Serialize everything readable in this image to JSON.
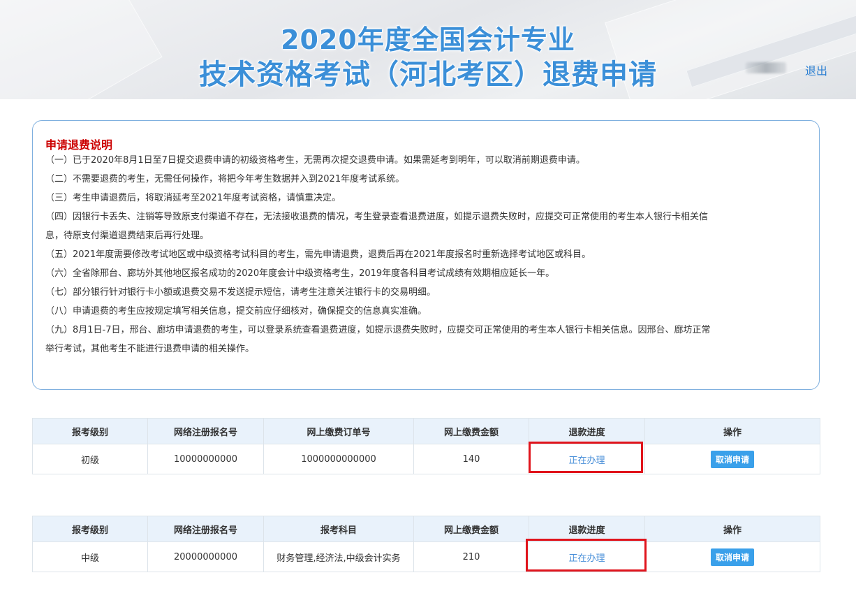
{
  "header": {
    "title_line1": "2020年度全国会计专业",
    "title_line2": "技术资格考试（河北考区）退费申请",
    "logout_label": "退出"
  },
  "notice": {
    "title": "申请退费说明",
    "items": [
      "（一）已于2020年8月1日至7日提交退费申请的初级资格考生，无需再次提交退费申请。如果需延考到明年，可以取消前期退费申请。",
      "（二）不需要退费的考生，无需任何操作，将把今年考生数据并入到2021年度考试系统。",
      "（三）考生申请退费后，将取消延考至2021年度考试资格，请慎重决定。",
      "（四）因银行卡丢失、注销等导致原支付渠道不存在，无法接收退费的情况，考生登录查看退费进度，如提示退费失败时，应提交可正常使用的考生本人银行卡相关信",
      "息，待原支付渠道退费结束后再行处理。",
      "（五）2021年度需要修改考试地区或中级资格考试科目的考生，需先申请退费，退费后再在2021年度报名时重新选择考试地区或科目。",
      "（六）全省除邢台、廊坊外其他地区报名成功的2020年度会计中级资格考生，2019年度各科目考试成绩有效期相应延长一年。",
      "（七）部分银行针对银行卡小额或退费交易不发送提示短信，请考生注意关注银行卡的交易明细。",
      "（八）申请退费的考生应按规定填写相关信息，提交前应仔细核对，确保提交的信息真实准确。",
      "（九）8月1日-7日，邢台、廊坊申请退费的考生，可以登录系统查看退费进度，如提示退费失败时，应提交可正常使用的考生本人银行卡相关信息。因邢台、廊坊正常",
      "举行考试，其他考生不能进行退费申请的相关操作。"
    ]
  },
  "table1": {
    "headers": [
      "报考级别",
      "网络注册报名号",
      "网上缴费订单号",
      "网上缴费金额",
      "退款进度",
      "操作"
    ],
    "row": {
      "level": "初级",
      "reg_no": "10000000000",
      "order_no": "1000000000000",
      "amount": "140",
      "progress": "正在办理",
      "action": "取消申请"
    }
  },
  "table2": {
    "headers": [
      "报考级别",
      "网络注册报名号",
      "报考科目",
      "网上缴费金额",
      "退款进度",
      "操作"
    ],
    "row": {
      "level": "中级",
      "reg_no": "20000000000",
      "subjects": "财务管理,经济法,中级会计实务",
      "amount": "210",
      "progress": "正在办理",
      "action": "取消申请"
    }
  },
  "colors": {
    "title_blue": "#3b8fd8",
    "notice_title_red": "#cc0000",
    "highlight_red": "#e0141c",
    "button_blue": "#3aa0ea",
    "table_header_bg": "#e9f2fb"
  }
}
